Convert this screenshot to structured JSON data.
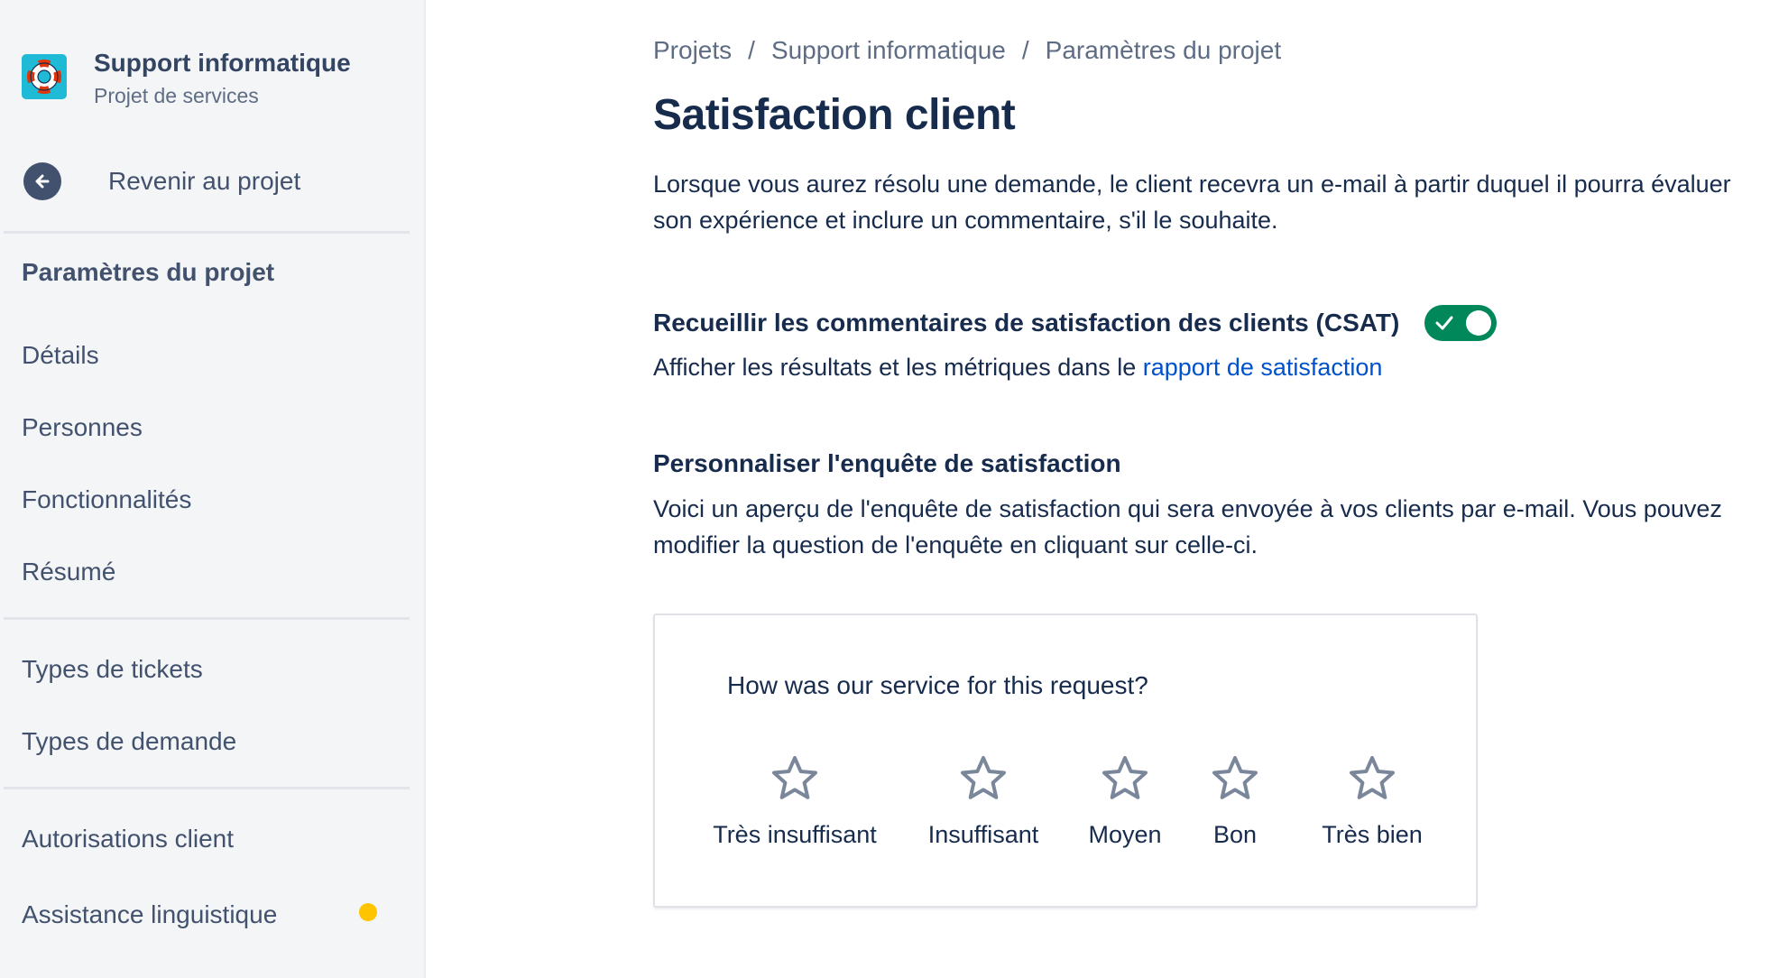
{
  "sidebar": {
    "project_name": "Support informatique",
    "project_type": "Projet de services",
    "back_label": "Revenir au projet",
    "section_title": "Paramètres du projet",
    "items": [
      {
        "label": "Détails"
      },
      {
        "label": "Personnes"
      },
      {
        "label": "Fonctionnalités"
      },
      {
        "label": "Résumé"
      },
      {
        "label": "Types de tickets"
      },
      {
        "label": "Types de demande"
      },
      {
        "label": "Autorisations client"
      },
      {
        "label": "Assistance linguistique"
      }
    ]
  },
  "breadcrumb": [
    "Projets",
    "Support informatique",
    "Paramètres du projet"
  ],
  "breadcrumb_separator": "/",
  "page": {
    "title": "Satisfaction client",
    "description": "Lorsque vous aurez résolu une demande, le client recevra un e-mail à partir duquel il pourra évaluer son expérience et inclure un commentaire, s'il le souhaite.",
    "csat_label": "Recueillir les commentaires de satisfaction des clients (CSAT)",
    "csat_enabled": true,
    "metrics_text": "Afficher les résultats et les métriques dans le ",
    "metrics_link": "rapport de satisfaction",
    "custom_title": "Personnaliser l'enquête de satisfaction",
    "custom_description": "Voici un aperçu de l'enquête de satisfaction qui sera envoyée à vos clients par e-mail. Vous pouvez modifier la question de l'enquête en cliquant sur celle-ci."
  },
  "survey": {
    "question": "How was our service for this request?",
    "ratings": [
      "Très insuffisant",
      "Insuffisant",
      "Moyen",
      "Bon",
      "Très bien"
    ]
  },
  "colors": {
    "toggle_on": "#00875a",
    "link": "#0052cc",
    "project_avatar": "#1fbad6",
    "notification_dot": "#ffc400"
  },
  "icons": {
    "project": "lifebuoy-icon",
    "back": "arrow-left-icon",
    "toggle_check": "check-icon",
    "rating": "star-outline-icon"
  }
}
